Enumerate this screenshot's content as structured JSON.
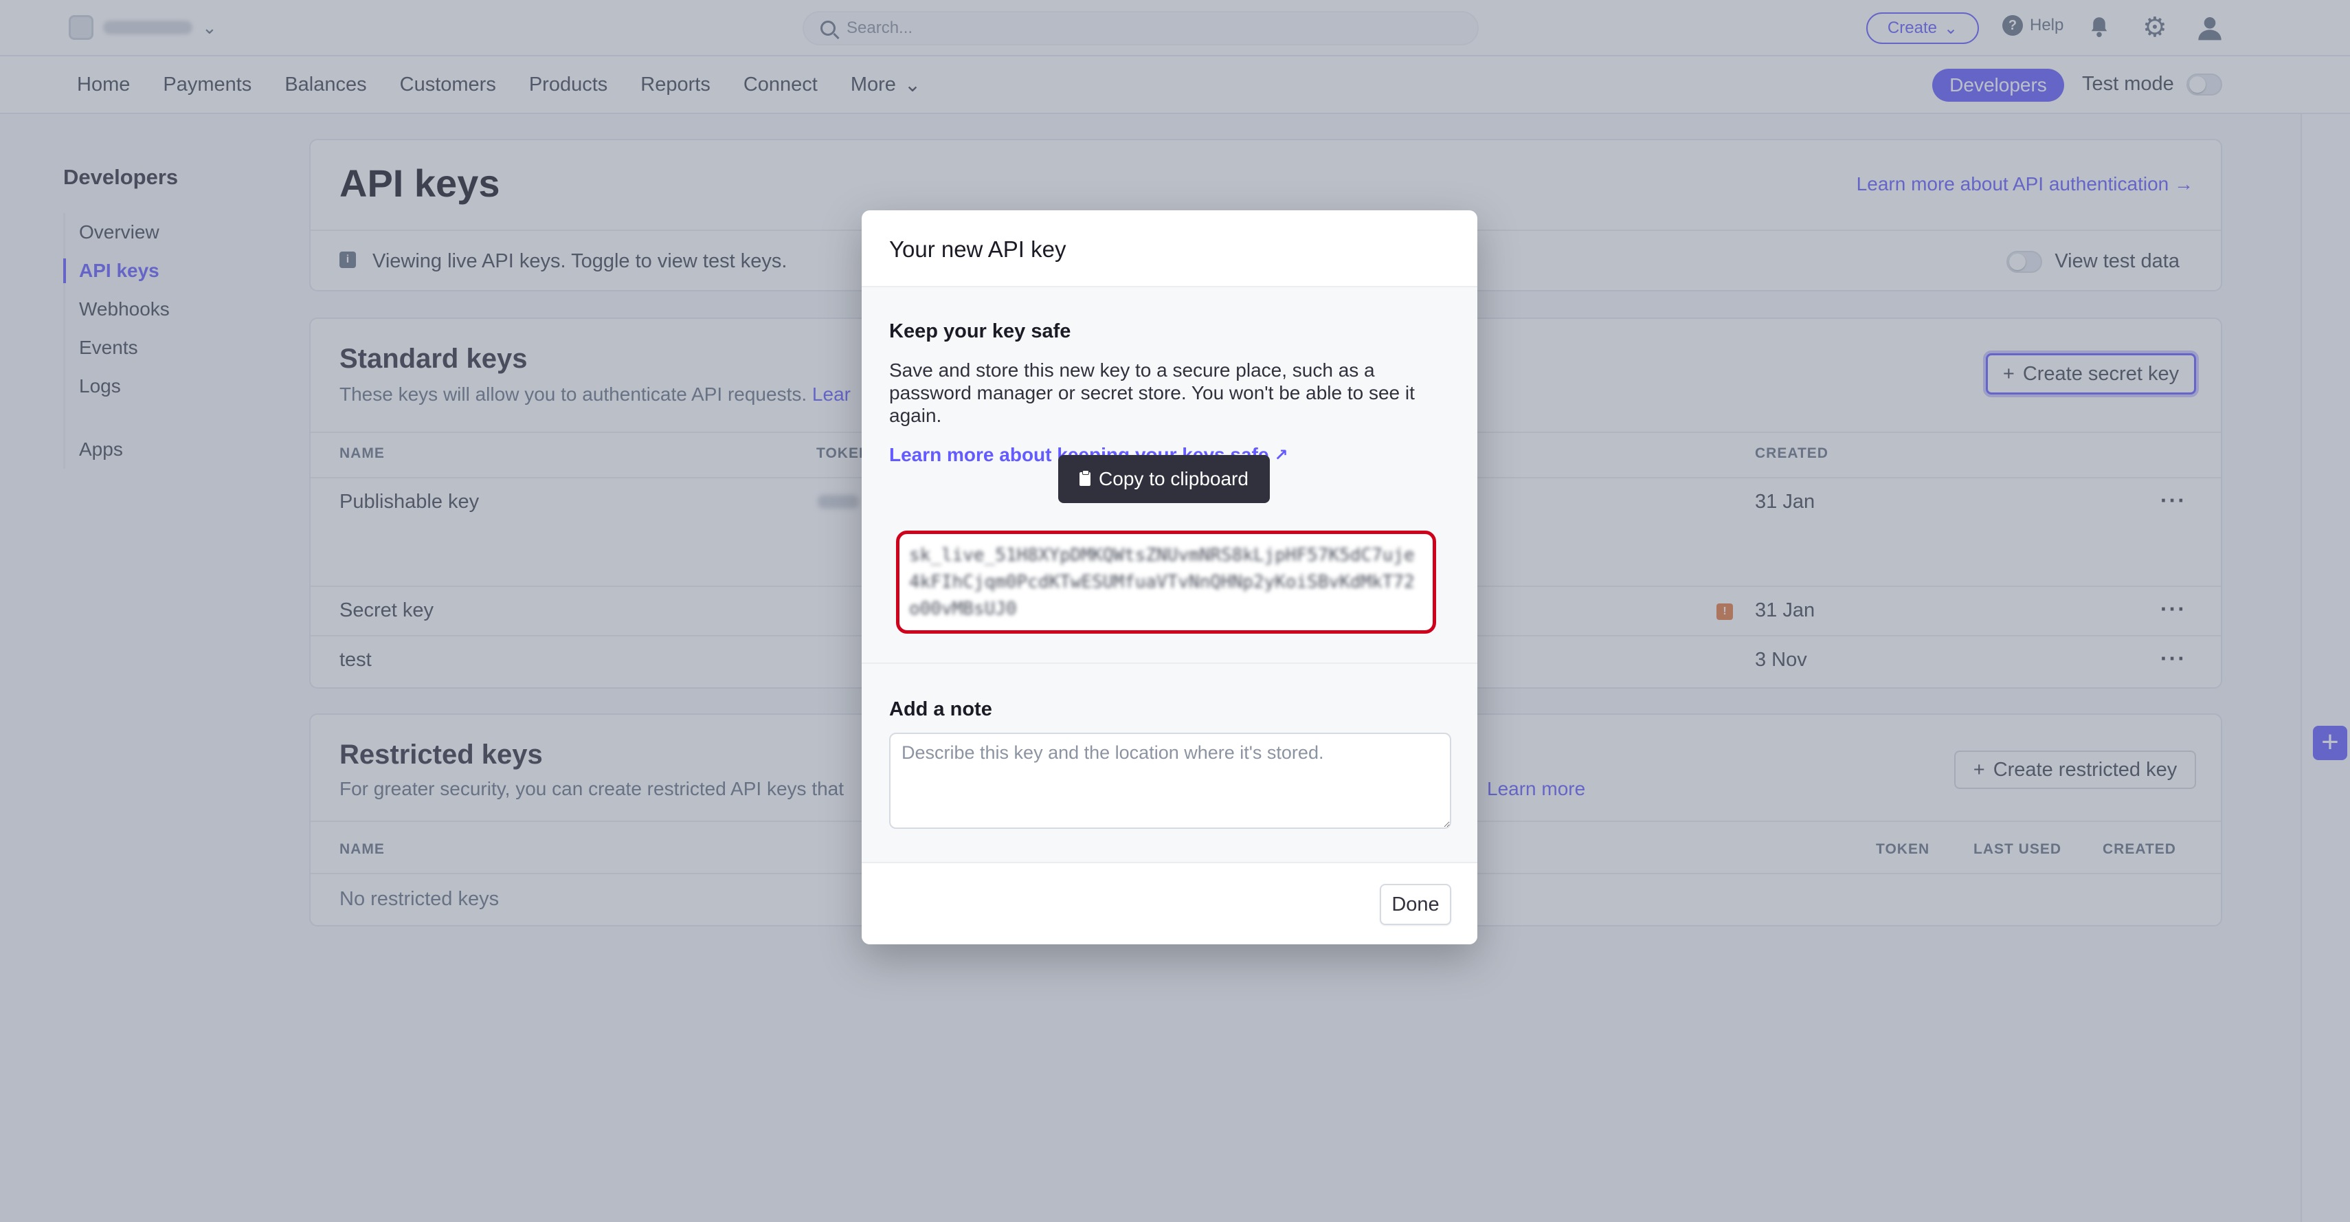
{
  "topbar": {
    "search_placeholder": "Search...",
    "create_label": "Create",
    "help_label": "Help"
  },
  "nav": {
    "items": [
      "Home",
      "Payments",
      "Balances",
      "Customers",
      "Products",
      "Reports",
      "Connect",
      "More"
    ],
    "developers_label": "Developers",
    "test_mode_label": "Test mode"
  },
  "sidebar": {
    "title": "Developers",
    "items": [
      {
        "label": "Overview"
      },
      {
        "label": "API keys"
      },
      {
        "label": "Webhooks"
      },
      {
        "label": "Events"
      },
      {
        "label": "Logs"
      }
    ],
    "apps_label": "Apps"
  },
  "api_keys": {
    "title": "API keys",
    "learn_auth_link": "Learn more about API authentication →",
    "info_text": "Viewing live API keys. Toggle to view test keys.",
    "view_test_data_label": "View test data"
  },
  "standard_keys": {
    "title": "Standard keys",
    "subtitle": "These keys will allow you to authenticate API requests.",
    "subtitle_link": "Lear",
    "create_button": "Create secret key",
    "columns": {
      "name": "NAME",
      "token": "TOKEN",
      "created": "CREATED"
    },
    "rows": [
      {
        "name": "Publishable key",
        "created": "31 Jan"
      },
      {
        "name": "Secret key",
        "created": "31 Jan"
      },
      {
        "name": "test",
        "created": "3 Nov"
      }
    ]
  },
  "restricted_keys": {
    "title": "Restricted keys",
    "subtitle": "For greater security, you can create restricted API keys that",
    "subtitle_link": "Learn more",
    "create_button": "Create restricted key",
    "columns": {
      "name": "NAME",
      "token": "TOKEN",
      "last_used": "LAST USED",
      "created": "CREATED"
    },
    "empty_text": "No restricted keys"
  },
  "modal": {
    "title": "Your new API key",
    "keep_title": "Keep your key safe",
    "keep_desc": "Save and store this new key to a secure place, such as a password manager or secret store. You won't be able to see it again.",
    "keep_link": "Learn more about keeping your keys safe",
    "tooltip": "Copy to clipboard",
    "key_value": "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",
    "note_title": "Add a note",
    "note_placeholder": "Describe this key and the location where it's stored.",
    "done_label": "Done"
  },
  "colors": {
    "accent": "#635bff",
    "highlight_border": "#d0021b"
  }
}
